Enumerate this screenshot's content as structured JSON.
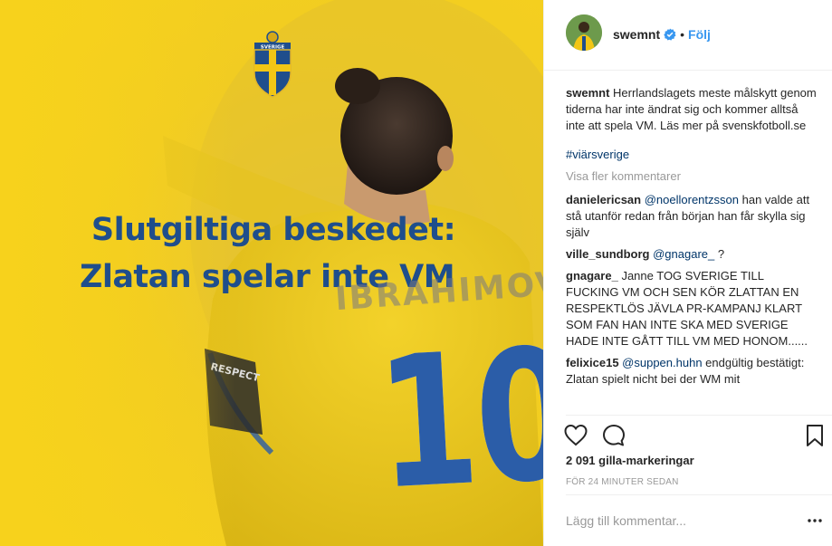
{
  "image": {
    "crest_text": "SVERIGE",
    "headline_line1": "Slutgiltiga beskedet:",
    "headline_line2": "Zlatan spelar inte VM",
    "jersey_name": "IBRAHIMOVIĆ",
    "jersey_number": "10",
    "armband_text": "RESPECT",
    "colors": {
      "background": "#f7d21c",
      "headline": "#1f4e8c",
      "jersey_number": "#2b5da8"
    }
  },
  "header": {
    "username": "swemnt",
    "separator": "•",
    "follow_label": "Följ"
  },
  "caption": {
    "author": "swemnt",
    "text": "Herrlandslagets meste målskytt genom tiderna har inte ändrat sig och kommer alltså inte att spela VM. Läs mer på svenskfotboll.se",
    "hashtag": "#viärsverige"
  },
  "more_comments_label": "Visa fler kommentarer",
  "comments": [
    {
      "author": "danielericsan",
      "mention": "@noellorentzsson",
      "text": " han valde att stå utanför redan från början han får skylla sig själv"
    },
    {
      "author": "ville_sundborg",
      "mention": "@gnagare_",
      "text": " ?"
    },
    {
      "author": "gnagare_",
      "mention": "",
      "text": "Janne TOG SVERIGE TILL FUCKING VM OCH SEN KÖR ZLATTAN EN RESPEKTLÖS JÄVLA PR-KAMPANJ KLART SOM FAN HAN INTE SKA MED SVERIGE HADE INTE GÅTT TILL VM MED HONOM......"
    },
    {
      "author": "felixice15",
      "mention": "@suppen.huhn",
      "text": " endgültig bestätigt: Zlatan spielt nicht bei der WM mit"
    }
  ],
  "likes": "2 091 gilla-markeringar",
  "timestamp": "FÖR 24 MINUTER SEDAN",
  "comment_placeholder": "Lägg till kommentar...",
  "icons": {
    "like": "heart-icon",
    "comment": "comment-bubble-icon",
    "save": "bookmark-icon",
    "verified": "verified-badge-icon",
    "options": "more-options-icon"
  },
  "accent_color": "#3897f0"
}
